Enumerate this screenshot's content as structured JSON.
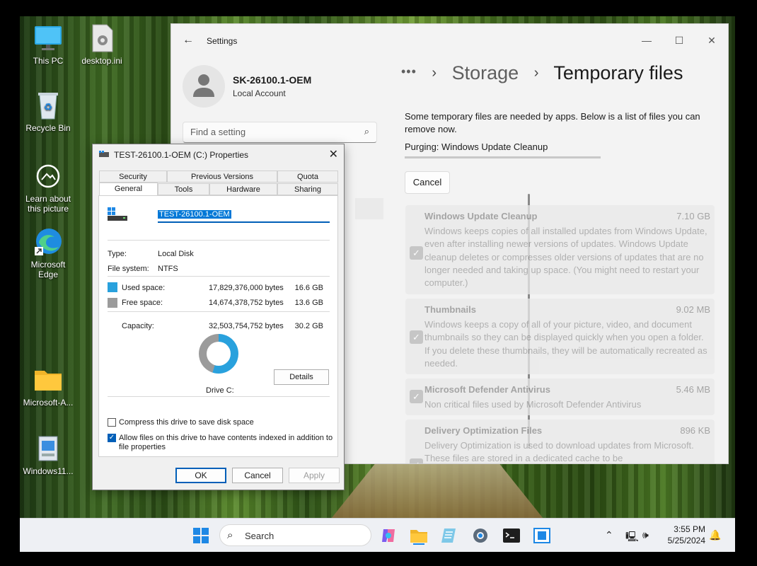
{
  "desktop": {
    "icons": [
      {
        "label": "This PC",
        "icon": "monitor-icon"
      },
      {
        "label": "desktop.ini",
        "icon": "settings-file-icon"
      },
      {
        "label": "Recycle Bin",
        "icon": "recycle-bin-icon"
      },
      {
        "label": "Learn about this picture",
        "icon": "camera-icon"
      },
      {
        "label": "Microsoft Edge",
        "icon": "edge-icon"
      },
      {
        "label": "Microsoft-A...",
        "icon": "folder-icon"
      },
      {
        "label": "Windows11...",
        "icon": "installer-icon"
      }
    ]
  },
  "settings": {
    "app_title": "Settings",
    "account": {
      "name": "SK-26100.1-OEM",
      "type": "Local Account"
    },
    "search_placeholder": "Find a setting",
    "breadcrumb": {
      "ellipsis": "•••",
      "parent": "Storage",
      "current": "Temporary files"
    },
    "intro": "Some temporary files are needed by apps. Below is a list of files you can remove now.",
    "status": "Purging: Windows Update Cleanup",
    "cancel_label": "Cancel",
    "items": [
      {
        "name": "Windows Update Cleanup",
        "size": "7.10 GB",
        "checked": true,
        "desc": "Windows keeps copies of all installed updates from Windows Update, even after installing newer versions of updates. Windows Update cleanup deletes or compresses older versions of updates that are no longer needed and taking up space. (You might need to restart your computer.)"
      },
      {
        "name": "Thumbnails",
        "size": "9.02 MB",
        "checked": true,
        "desc": "Windows keeps a copy of all of your picture, video, and document thumbnails so they can be displayed quickly when you open a folder. If you delete these thumbnails, they will be automatically recreated as needed."
      },
      {
        "name": "Microsoft Defender Antivirus",
        "size": "5.46 MB",
        "checked": true,
        "desc": "Non critical files used by Microsoft Defender Antivirus"
      },
      {
        "name": "Delivery Optimization Files",
        "size": "896 KB",
        "checked": true,
        "desc": "Delivery Optimization is used to download updates from Microsoft. These files are stored in a dedicated cache to be"
      }
    ]
  },
  "properties": {
    "title": "TEST-26100.1-OEM (C:) Properties",
    "tabs_row1": [
      "Security",
      "Previous Versions",
      "Quota"
    ],
    "tabs_row2": [
      "General",
      "Tools",
      "Hardware",
      "Sharing"
    ],
    "active_tab": "General",
    "volume_label": "TEST-26100.1-OEM",
    "type_label": "Type:",
    "type_value": "Local Disk",
    "fs_label": "File system:",
    "fs_value": "NTFS",
    "used": {
      "label": "Used space:",
      "bytes": "17,829,376,000 bytes",
      "size": "16.6 GB"
    },
    "free": {
      "label": "Free space:",
      "bytes": "14,674,378,752 bytes",
      "size": "13.6 GB"
    },
    "capacity": {
      "label": "Capacity:",
      "bytes": "32,503,754,752 bytes",
      "size": "30.2 GB"
    },
    "used_fraction": 0.549,
    "drive_label": "Drive C:",
    "details_label": "Details",
    "compress_label": "Compress this drive to save disk space",
    "compress_checked": false,
    "index_label_1": "Allow files on this drive to have contents indexed in addition to",
    "index_label_2": "file properties",
    "index_checked": true,
    "ok_label": "OK",
    "cancel_label": "Cancel",
    "apply_label": "Apply",
    "colors": {
      "used": "#29a1dd",
      "free": "#9b9b9b"
    }
  },
  "taskbar": {
    "search_label": "Search",
    "time": "3:55 PM",
    "date": "5/25/2024"
  }
}
